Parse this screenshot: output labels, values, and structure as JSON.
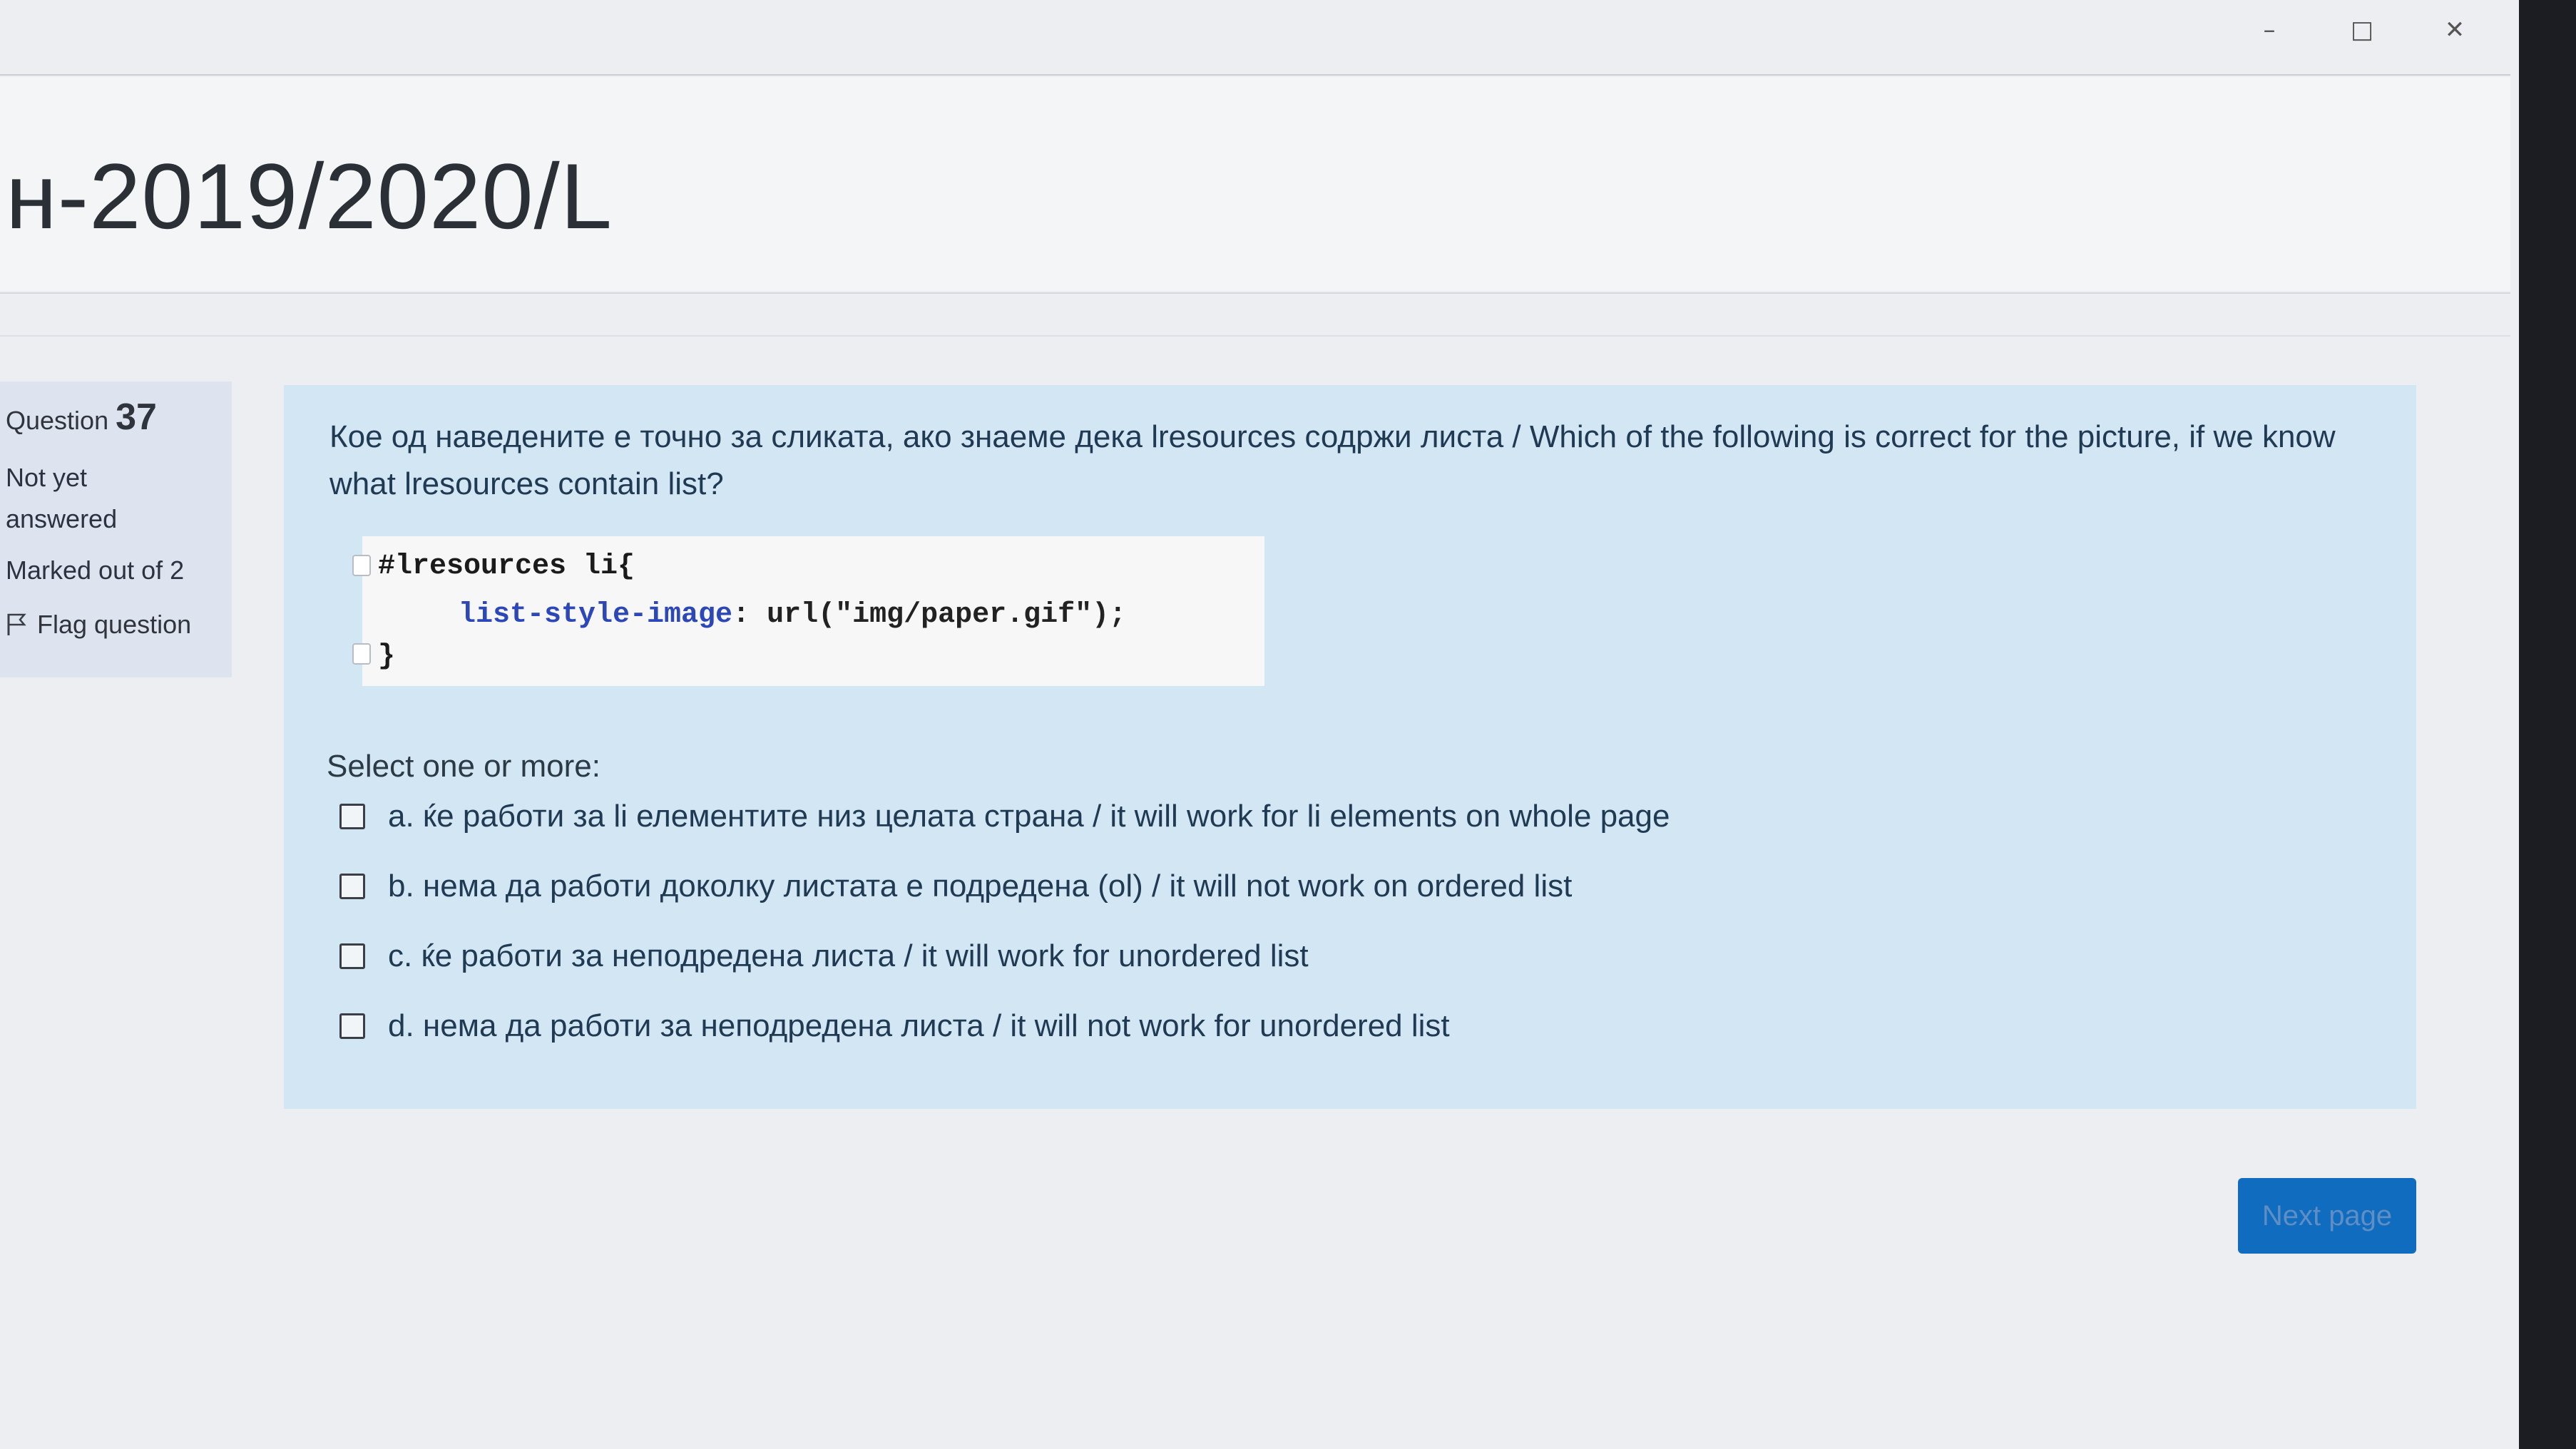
{
  "page": {
    "title": "н-2019/2020/L"
  },
  "window_controls": {
    "minimize": "–",
    "maximize": "□",
    "close": "✕"
  },
  "question_info": {
    "label": "Question",
    "number": "37",
    "state": "Not yet answered",
    "grade": "Marked out of 2",
    "flag_label": "Flag question",
    "flag_icon": "flag-icon"
  },
  "question": {
    "text": "Кое од наведените е точно за сликата, ако знаеме дека lresources содржи листа / Which of the following is correct for the picture, if we know what lresources contain list?",
    "code": {
      "line1": "#lresources li{",
      "line2_prop": "list-style-image",
      "line2_rest": ": url(\"img/paper.gif\");",
      "line3": "}"
    },
    "prompt": "Select one or more:",
    "options": [
      {
        "label": "a. ќе работи за li елементите низ целата страна / it will work for li elements on whole page"
      },
      {
        "label": "b. нема да работи доколку листата е подредена (ol) / it will not work on ordered list"
      },
      {
        "label": "c. ќе работи за неподредена листа / it will work for unordered list"
      },
      {
        "label": "d. нема да работи за неподредена листа / it will not work for unordered list"
      }
    ]
  },
  "navigation": {
    "next_label": "Next page"
  },
  "colors": {
    "card_bg": "#d3e6f3",
    "info_bg": "#dde4ef",
    "button": "#0f6cbf"
  }
}
